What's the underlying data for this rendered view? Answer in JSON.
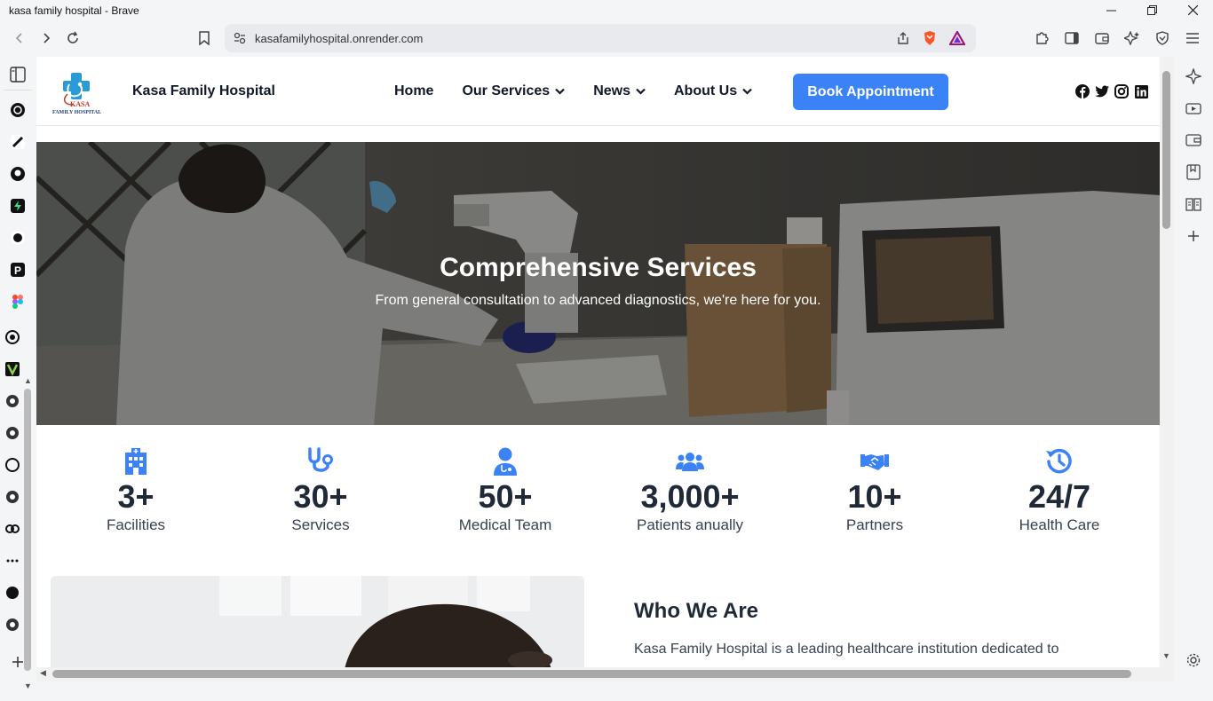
{
  "window": {
    "title": "kasa family hospital - Brave"
  },
  "browser": {
    "url": "kasafamilyhospital.onrender.com"
  },
  "site": {
    "brand": "Kasa Family Hospital",
    "logo_text_top": "KASA",
    "logo_text_bottom": "FAMILY HOSPITAL",
    "nav": [
      {
        "label": "Home",
        "dropdown": false
      },
      {
        "label": "Our Services",
        "dropdown": true
      },
      {
        "label": "News",
        "dropdown": true
      },
      {
        "label": "About Us",
        "dropdown": true
      }
    ],
    "cta": "Book Appointment",
    "social_icons": [
      "facebook-icon",
      "twitter-icon",
      "instagram-icon",
      "linkedin-icon"
    ],
    "accent_color": "#3b82f6"
  },
  "hero": {
    "title": "Comprehensive Services",
    "subtitle": "From general consultation to advanced diagnostics, we're here for you."
  },
  "stats": [
    {
      "icon": "hospital-icon",
      "value": "3+",
      "label": "Facilities"
    },
    {
      "icon": "stethoscope-icon",
      "value": "30+",
      "label": "Services"
    },
    {
      "icon": "doctor-icon",
      "value": "50+",
      "label": "Medical Team"
    },
    {
      "icon": "users-icon",
      "value": "3,000+",
      "label": "Patients anually"
    },
    {
      "icon": "handshake-icon",
      "value": "10+",
      "label": "Partners"
    },
    {
      "icon": "history-icon",
      "value": "24/7",
      "label": "Health Care"
    }
  ],
  "about": {
    "title": "Who We Are",
    "text": "Kasa Family Hospital is a leading healthcare institution dedicated to"
  }
}
